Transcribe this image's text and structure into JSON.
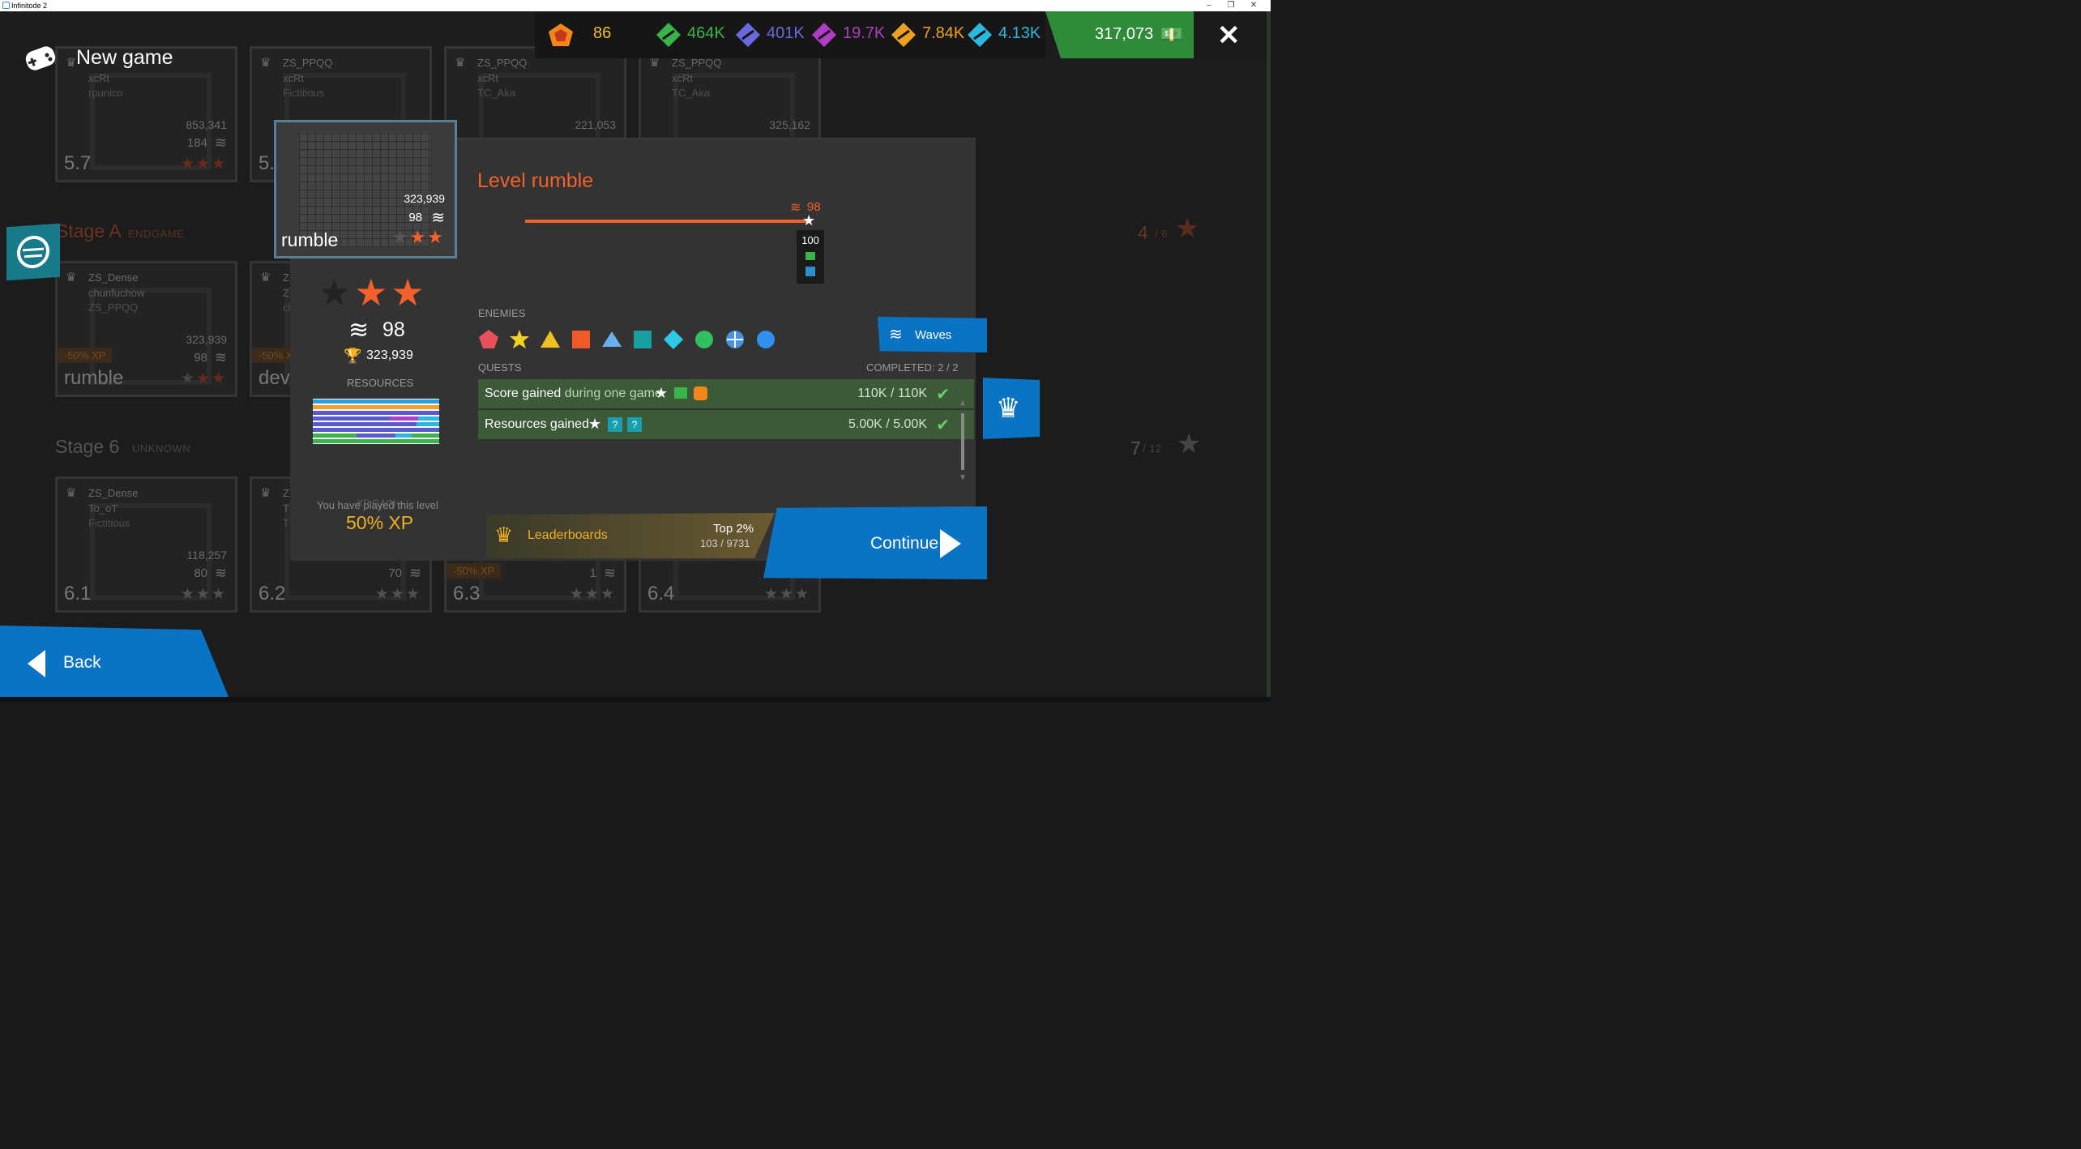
{
  "window": {
    "title": "Infinitode 2",
    "minimize": "–",
    "restore": "❐",
    "close": "✕"
  },
  "header": {
    "title": "New game",
    "icon": "gamepad-icon"
  },
  "topbar": {
    "bits_value": "86",
    "resources": [
      {
        "name": "green-resource-icon",
        "value": "464K",
        "color": "#3ab44a"
      },
      {
        "name": "violet-resource-icon",
        "value": "401K",
        "color": "#6a6ae0"
      },
      {
        "name": "purple-resource-icon",
        "value": "19.7K",
        "color": "#b03cc8"
      },
      {
        "name": "orange-resource-icon",
        "value": "7.84K",
        "color": "#f0a020"
      },
      {
        "name": "cyan-resource-icon",
        "value": "4.13K",
        "color": "#2ab8e0"
      }
    ],
    "money": "317,073"
  },
  "background_cards": [
    {
      "title": "",
      "sub1": "xcRt",
      "sub2": "rpunico",
      "score": "853,341",
      "waves": "184",
      "level": "5.7"
    },
    {
      "title": "ZS_PPQQ",
      "sub1": "xcRt",
      "sub2": "Fictitious",
      "score": "",
      "waves": "",
      "level": "5."
    },
    {
      "title": "ZS_PPQQ",
      "sub1": "xcRt",
      "sub2": "TC_Aka",
      "score": "221,053",
      "waves": "",
      "level": ""
    },
    {
      "title": "ZS_PPQQ",
      "sub1": "xcRt",
      "sub2": "TC_Aka",
      "score": "325,162",
      "waves": "",
      "level": ""
    },
    {
      "title": "ZS_Dense",
      "sub1": "chunfuchow",
      "sub2": "ZS_PPQQ",
      "score": "323,939",
      "waves": "98",
      "level": "rumble",
      "badge": "-50% XP"
    },
    {
      "title": "ZS",
      "sub1": "ZS",
      "sub2": "ch",
      "score": "",
      "waves": "",
      "level": "dev",
      "badge": "-50% X"
    },
    {
      "title": "ZS_Dense",
      "sub1": "To_oT",
      "sub2": "Fictitious",
      "score": "118,257",
      "waves": "80",
      "level": "6.1"
    },
    {
      "title": "Z",
      "sub1": "T",
      "sub2": "T",
      "score": "",
      "waves": "70",
      "level": "6.2"
    },
    {
      "title": "",
      "sub1": "",
      "sub2": "",
      "score": "",
      "waves": "1",
      "level": "6.3",
      "badge": "-50% XP"
    },
    {
      "title": "",
      "sub1": "",
      "sub2": "",
      "score": "",
      "waves": "",
      "level": "6.4"
    }
  ],
  "stages": [
    {
      "label": "Stage A",
      "sub": "ENDGAME",
      "progress": "4",
      "total": "/ 6"
    },
    {
      "label": "Stage 6",
      "sub": "UNKNOWN",
      "progress": "7",
      "total": "/ 12"
    }
  ],
  "dialog": {
    "preview": {
      "name": "rumble",
      "score": "323,939",
      "waves": "98",
      "stars_earned": 2,
      "stars_total": 3
    },
    "title": "Level rumble",
    "wave_marker": "98",
    "milestone": {
      "waves": "100"
    },
    "stats": {
      "waves": "98",
      "score": "323,939",
      "stars_earned": 2
    },
    "resources_label": "RESOURCES",
    "xp": {
      "overlay_text": "You have played this level",
      "label_under": "XP GAIN",
      "value": "50% XP"
    },
    "enemies_label": "ENEMIES",
    "enemies": [
      {
        "name": "pentagon-enemy-icon",
        "color": "#e8505a"
      },
      {
        "name": "star-enemy-icon",
        "color": "#f0d020"
      },
      {
        "name": "triangle-enemy-icon",
        "color": "#f0c020"
      },
      {
        "name": "square-enemy-icon",
        "color": "#f05a28"
      },
      {
        "name": "light-triangle-enemy-icon",
        "color": "#6ab0f0"
      },
      {
        "name": "teal-square-enemy-icon",
        "color": "#18a0a0"
      },
      {
        "name": "diamond-enemy-icon",
        "color": "#30c8e8"
      },
      {
        "name": "circle-enemy-icon",
        "color": "#30c060"
      },
      {
        "name": "snowflake-enemy-icon",
        "color": "#4a90e0"
      },
      {
        "name": "blue-circle-enemy-icon",
        "color": "#3090f0"
      }
    ],
    "waves_button": "Waves",
    "quests_label": "QUESTS",
    "completed_label": "COMPLETED: 2 / 2",
    "quests": [
      {
        "label": "Score gained",
        "label_extra": "during one game",
        "progress": "110K / 110K"
      },
      {
        "label": "Resources gained",
        "label_extra": "",
        "progress": "5.00K / 5.00K"
      }
    ],
    "leaderboards": {
      "label": "Leaderboards",
      "top": "Top 2%",
      "rank": "103 / 9731"
    },
    "continue_button": "Continue"
  },
  "back_button": "Back",
  "colors": {
    "accent_orange": "#f4602a",
    "accent_blue": "#0b73c4",
    "gold": "#f0b020",
    "quest_green": "#3c5a38"
  }
}
